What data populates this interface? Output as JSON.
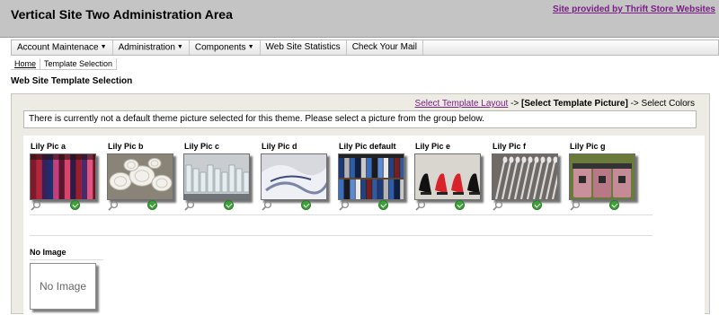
{
  "header": {
    "title": "Vertical Site Two Administration Area",
    "provider_link": "Site provided by Thrift Store Websites"
  },
  "menu": {
    "items": [
      {
        "label": "Account Maintenace",
        "has_dropdown": true
      },
      {
        "label": "Administration",
        "has_dropdown": true
      },
      {
        "label": "Components",
        "has_dropdown": true
      },
      {
        "label": "Web Site Statistics",
        "has_dropdown": false
      },
      {
        "label": "Check Your Mail",
        "has_dropdown": false
      }
    ],
    "dropdown_glyph": "▼"
  },
  "breadcrumb": {
    "home": "Home",
    "current": "Template Selection"
  },
  "page": {
    "title": "Web Site Template Selection"
  },
  "steps": {
    "step1": "Select Template Layout",
    "sep": " -> ",
    "step2": "[Select Template Picture]",
    "step3": "Select Colors"
  },
  "notice": "There is currently not a default theme picture selected for this theme. Please select a picture from the group below.",
  "pictures": [
    {
      "name": "Lily Pic a",
      "subject": "colorful fabrics"
    },
    {
      "name": "Lily Pic b",
      "subject": "white dishes"
    },
    {
      "name": "Lily Pic c",
      "subject": "glassware"
    },
    {
      "name": "Lily Pic d",
      "subject": "linens"
    },
    {
      "name": "Lily Pic default",
      "subject": "bookshelf"
    },
    {
      "name": "Lily Pic e",
      "subject": "shoes"
    },
    {
      "name": "Lily Pic f",
      "subject": "silverware"
    },
    {
      "name": "Lily Pic g",
      "subject": "kitchen canisters"
    }
  ],
  "no_image": {
    "name": "No Image",
    "box_text": "No Image"
  },
  "icons": {
    "preview": "magnifier-icon",
    "select": "check-icon",
    "check_color": "#3ea03a"
  },
  "colors": {
    "header_bg": "#c4c4c4",
    "link": "#7a1d86",
    "panel_bg": "#ecece4"
  }
}
